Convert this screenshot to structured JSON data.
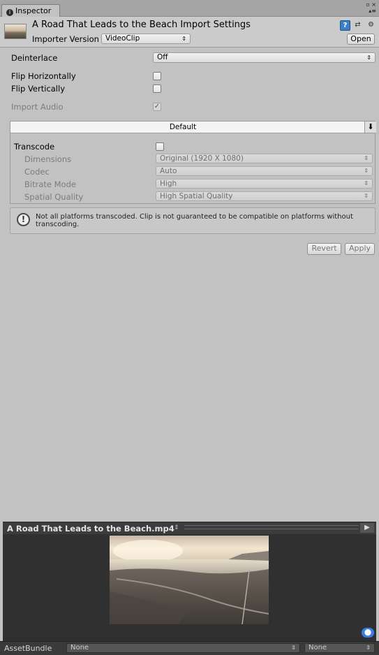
{
  "tab": {
    "label": "Inspector"
  },
  "window_controls": {
    "top": "▫ ×",
    "bottom": "▴≡"
  },
  "header": {
    "title": "A Road That Leads to the Beach Import Settings",
    "importer_label": "Importer Version",
    "importer_value": "VideoClip",
    "open_label": "Open"
  },
  "settings": {
    "deinterlace_label": "Deinterlace",
    "deinterlace_value": "Off",
    "flip_h_label": "Flip Horizontally",
    "flip_h_checked": false,
    "flip_v_label": "Flip Vertically",
    "flip_v_checked": false,
    "import_audio_label": "Import Audio",
    "import_audio_checked": true
  },
  "platform": {
    "tab_label": "Default",
    "transcode_label": "Transcode",
    "transcode_checked": false,
    "fields": [
      {
        "label": "Dimensions",
        "value": "Original (1920 X 1080)"
      },
      {
        "label": "Codec",
        "value": "Auto"
      },
      {
        "label": "Bitrate Mode",
        "value": "High"
      },
      {
        "label": "Spatial Quality",
        "value": "High Spatial Quality"
      }
    ]
  },
  "help": {
    "text": "Not all platforms transcoded. Clip is not guaranteed to be compatible on platforms without transcoding."
  },
  "actions": {
    "revert_label": "Revert",
    "apply_label": "Apply"
  },
  "preview": {
    "title": "A Road That Leads to the Beach.mp4",
    "title_arrow": "⇕",
    "play_icon": "▶"
  },
  "asset_bundle": {
    "label": "AssetBundle",
    "name_value": "None",
    "variant_value": "None"
  },
  "colors": {
    "panel_bg": "#c2c2c2",
    "preview_bg": "#303030",
    "accent": "#3c7fc4"
  }
}
